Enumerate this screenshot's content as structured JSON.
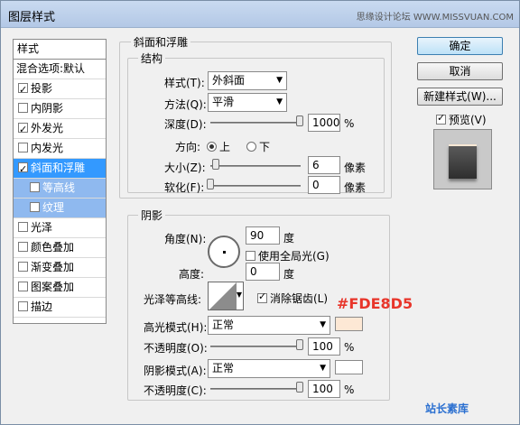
{
  "window": {
    "title": "图层样式",
    "watermark": "思缘设计论坛 WWW.MISSVUAN.COM"
  },
  "left_panel": {
    "header": "样式",
    "items": [
      {
        "label": "混合选项:默认",
        "checkbox": false,
        "checked": false,
        "state": "header"
      },
      {
        "label": "投影",
        "checkbox": true,
        "checked": true,
        "state": "normal"
      },
      {
        "label": "内阴影",
        "checkbox": true,
        "checked": false,
        "state": "normal"
      },
      {
        "label": "外发光",
        "checkbox": true,
        "checked": true,
        "state": "normal"
      },
      {
        "label": "内发光",
        "checkbox": true,
        "checked": false,
        "state": "normal"
      },
      {
        "label": "斜面和浮雕",
        "checkbox": true,
        "checked": true,
        "state": "selected"
      },
      {
        "label": "等高线",
        "checkbox": true,
        "checked": false,
        "state": "sub"
      },
      {
        "label": "纹理",
        "checkbox": true,
        "checked": false,
        "state": "sub"
      },
      {
        "label": "光泽",
        "checkbox": true,
        "checked": false,
        "state": "normal"
      },
      {
        "label": "颜色叠加",
        "checkbox": true,
        "checked": false,
        "state": "normal"
      },
      {
        "label": "渐变叠加",
        "checkbox": true,
        "checked": false,
        "state": "normal"
      },
      {
        "label": "图案叠加",
        "checkbox": true,
        "checked": false,
        "state": "normal"
      },
      {
        "label": "描边",
        "checkbox": true,
        "checked": false,
        "state": "normal"
      }
    ]
  },
  "bevel": {
    "group_title": "斜面和浮雕",
    "structure_title": "结构",
    "style_label": "样式(T):",
    "style_value": "外斜面",
    "method_label": "方法(Q):",
    "method_value": "平滑",
    "depth_label": "深度(D):",
    "depth_value": "1000",
    "depth_unit": "%",
    "direction_label": "方向:",
    "dir_up": "上",
    "dir_down": "下",
    "size_label": "大小(Z):",
    "size_value": "6",
    "size_unit": "像素",
    "soften_label": "软化(F):",
    "soften_value": "0",
    "soften_unit": "像素"
  },
  "shading": {
    "title": "阴影",
    "angle_label": "角度(N):",
    "angle_value": "90",
    "angle_unit": "度",
    "global_light_label": "使用全局光(G)",
    "altitude_label": "高度:",
    "altitude_value": "0",
    "altitude_unit": "度",
    "gloss_label": "光泽等高线:",
    "antialias_label": "消除锯齿(L)",
    "highlight_mode_label": "高光模式(H):",
    "highlight_mode_value": "正常",
    "highlight_color": "#FDE8D5",
    "highlight_opacity_label": "不透明度(O):",
    "highlight_opacity_value": "100",
    "opacity_unit": "%",
    "shadow_mode_label": "阴影模式(A):",
    "shadow_mode_value": "正常",
    "shadow_color": "#FFFFFF",
    "shadow_opacity_label": "不透明度(C):",
    "shadow_opacity_value": "100"
  },
  "annotation": {
    "hex": "#FDE8D5"
  },
  "buttons": {
    "ok": "确定",
    "cancel": "取消",
    "new_style": "新建样式(W)...",
    "preview": "预览(V)"
  },
  "footer_logo": "站长素库"
}
